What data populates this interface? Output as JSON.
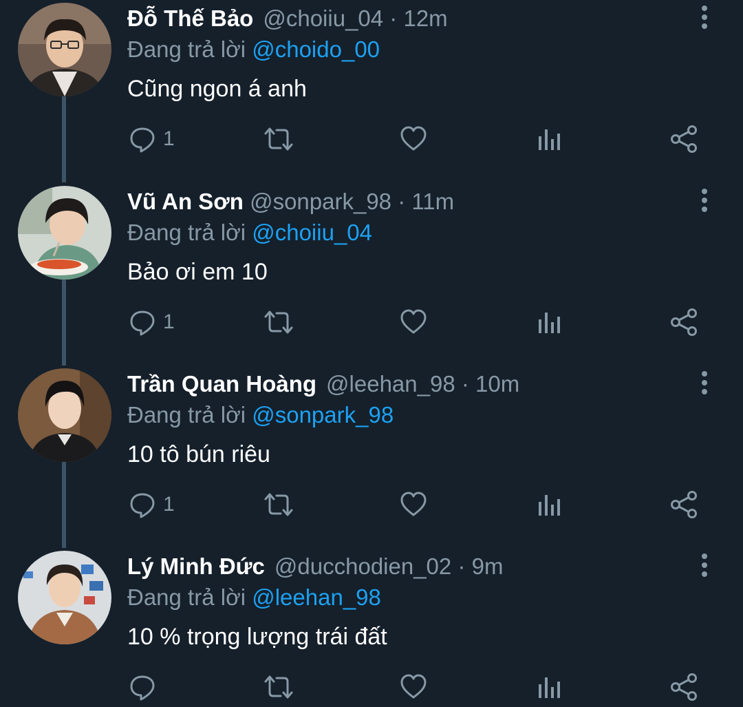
{
  "ui": {
    "reply_prefix": "Đang trả lời",
    "dot": "·"
  },
  "tweets": [
    {
      "name": "Đỗ Thế Bảo",
      "handle": "@choiiu_04",
      "time": "12m",
      "reply_to": "@choido_00",
      "text": "Cũng ngon á anh",
      "reply_count": "1"
    },
    {
      "name": "Vũ An Sơn",
      "handle": "@sonpark_98",
      "time": "11m",
      "reply_to": "@choiiu_04",
      "text": "Bảo ơi em 10",
      "reply_count": "1"
    },
    {
      "name": "Trần Quan Hoàng",
      "handle": "@leehan_98",
      "time": "10m",
      "reply_to": "@sonpark_98",
      "text": "10 tô bún riêu",
      "reply_count": "1"
    },
    {
      "name": "Lý Minh Đức",
      "handle": "@ducchodien_02",
      "time": "9m",
      "reply_to": "@leehan_98",
      "text": "10 % trọng lượng trái đất",
      "reply_count": ""
    }
  ],
  "colors": {
    "background": "#15202b",
    "name": "#ffffff",
    "secondary": "#8899a6",
    "link": "#1da1f2",
    "thread_line": "#3d5466"
  },
  "icons": [
    "more-vertical-icon",
    "reply-icon",
    "retweet-icon",
    "like-icon",
    "analytics-icon",
    "share-icon"
  ]
}
